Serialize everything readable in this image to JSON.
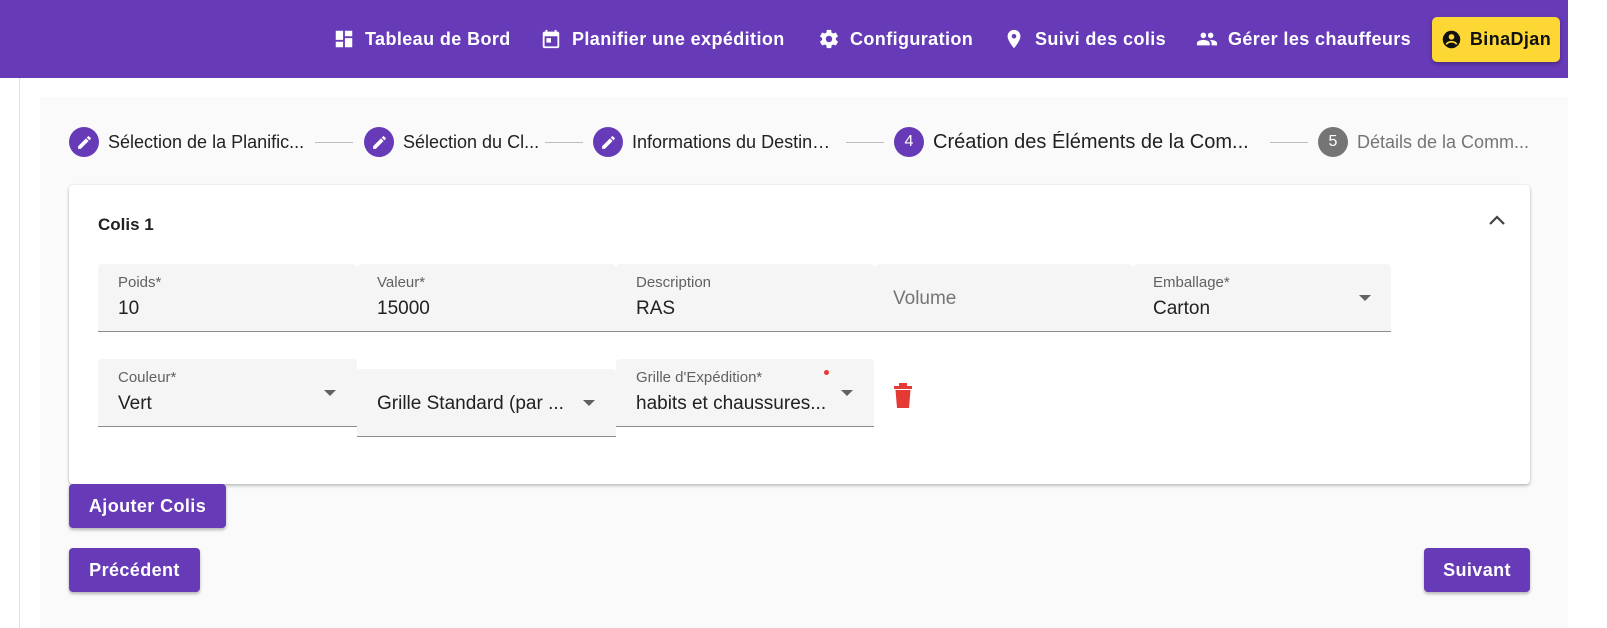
{
  "nav": {
    "items": [
      {
        "label": "Tableau de Bord",
        "icon": "dashboard-icon"
      },
      {
        "label": "Planifier une expédition",
        "icon": "calendar-icon"
      },
      {
        "label": "Configuration",
        "icon": "gear-icon"
      },
      {
        "label": "Suivi des colis",
        "icon": "location-pin-icon"
      },
      {
        "label": "Gérer les chauffeurs",
        "icon": "people-icon"
      }
    ],
    "user": {
      "label": "BinaDjan",
      "icon": "account-circle-icon"
    }
  },
  "stepper": {
    "steps": [
      {
        "label": "Sélection de la Planific...",
        "state": "completed",
        "icon": "edit-icon"
      },
      {
        "label": "Sélection du Cl...",
        "state": "completed",
        "icon": "edit-icon"
      },
      {
        "label": "Informations du Destina...",
        "state": "completed",
        "icon": "edit-icon"
      },
      {
        "number": "4",
        "label": "Création des Éléments de la Com...",
        "state": "active"
      },
      {
        "number": "5",
        "label": "Détails de la Comm...",
        "state": "inactive"
      }
    ]
  },
  "colis": {
    "title": "Colis 1",
    "fields": {
      "poids": {
        "label": "Poids*",
        "value": "10"
      },
      "valeur": {
        "label": "Valeur*",
        "value": "15000"
      },
      "description": {
        "label": "Description",
        "value": "RAS"
      },
      "volume": {
        "placeholder": "Volume"
      },
      "emballage": {
        "label": "Emballage*",
        "value": "Carton"
      },
      "couleur": {
        "label": "Couleur*",
        "value": "Vert"
      },
      "grille_type": {
        "value": "Grille Standard (par ..."
      },
      "grille_expedition": {
        "label": "Grille d'Expédition*",
        "value": "habits et chaussures..."
      }
    }
  },
  "buttons": {
    "add": "Ajouter Colis",
    "previous": "Précédent",
    "next": "Suivant"
  },
  "colors": {
    "primary": "#673ab7",
    "accent": "#fdd835",
    "danger": "#e53935"
  }
}
